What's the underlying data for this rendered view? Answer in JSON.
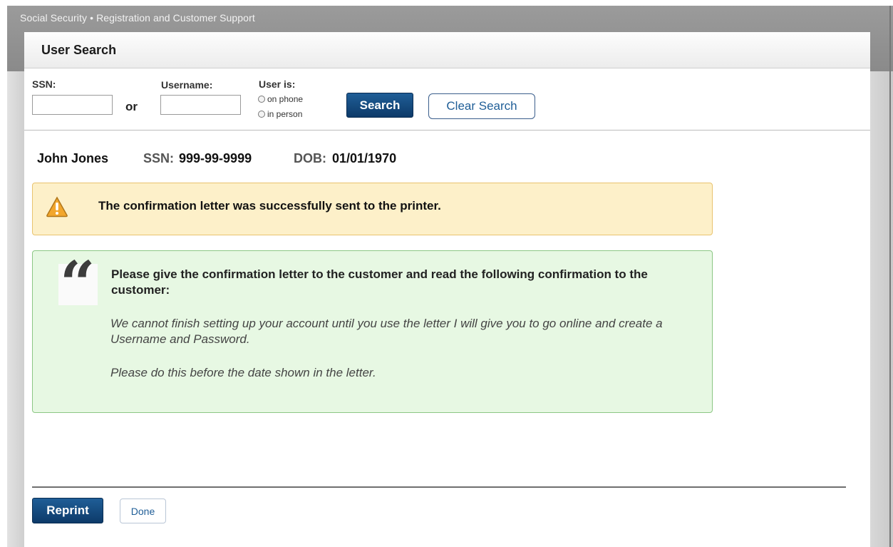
{
  "app": {
    "title": "Social Security • Registration and Customer Support"
  },
  "panel": {
    "title": "User Search"
  },
  "search": {
    "ssn_label": "SSN:",
    "ssn_value": "",
    "or_text": "or",
    "username_label": "Username:",
    "username_value": "",
    "user_is_label": "User is:",
    "options": [
      "on phone",
      "in person"
    ],
    "selected_option": null,
    "search_button": "Search",
    "clear_button": "Clear Search"
  },
  "person": {
    "name": "John Jones",
    "ssn_label": "SSN:",
    "ssn_value": "999-99-9999",
    "dob_label": "DOB:",
    "dob_value": "01/01/1970"
  },
  "warning": {
    "icon": "warning-triangle-icon",
    "message": "The confirmation letter was successfully sent to the printer."
  },
  "instructions": {
    "icon": "quote-icon",
    "heading": "Please give the confirmation letter to the customer and read the following confirmation to the customer:",
    "script_lines": [
      "We cannot finish setting up your account until you use the letter I will give you to go online and create a Username and Password.",
      "Please do this before the date shown in the letter."
    ]
  },
  "footer": {
    "reprint_button": "Reprint",
    "done_button": "Done"
  },
  "colors": {
    "primary_button": "#0d3a69",
    "warning_bg": "#fdf0c9",
    "info_bg": "#e7f8e3"
  }
}
